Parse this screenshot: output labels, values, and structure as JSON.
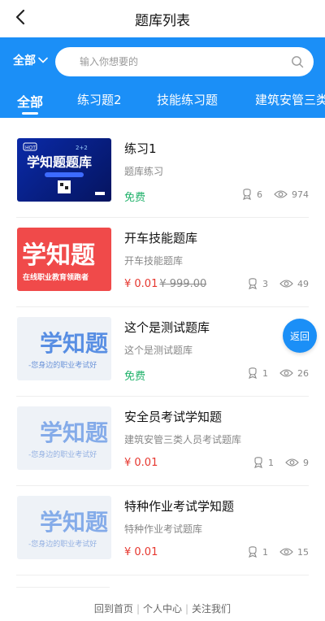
{
  "header": {
    "title": "题库列表"
  },
  "search": {
    "filter_label": "全部",
    "placeholder": "输入你想要的"
  },
  "tabs": [
    {
      "label": "全部"
    },
    {
      "label": "练习题2"
    },
    {
      "label": "技能练习题"
    },
    {
      "label": "建筑安管三类"
    }
  ],
  "items": [
    {
      "name": "练习1",
      "sub": "题库练习",
      "price": "免费",
      "old_price": "",
      "people": "6",
      "views": "974",
      "thumb_text": "学知题题库",
      "thumb_small": "HOT",
      "thumb_extra": "2+2"
    },
    {
      "name": "开车技能题库",
      "sub": "开车技能题库",
      "price": "¥ 0.01",
      "old_price": "¥ 999.00",
      "people": "3",
      "views": "49",
      "thumb_text": "学知题",
      "thumb_small": "在线职业教育领跑者"
    },
    {
      "name": "这个是测试题库",
      "sub": "这个是测试题库",
      "price": "免费",
      "old_price": "",
      "people": "1",
      "views": "26",
      "thumb_text": "学知题",
      "thumb_small": "-您身边的职业考试好"
    },
    {
      "name": "安全员考试学知题",
      "sub": "建筑安管三类人员考试题库",
      "price": "¥ 0.01",
      "old_price": "",
      "people": "1",
      "views": "9",
      "thumb_text": "学知题",
      "thumb_small": "-您身边的职业考试好"
    },
    {
      "name": "特种作业考试学知题",
      "sub": "特种作业考试题库",
      "price": "¥ 0.01",
      "old_price": "",
      "people": "1",
      "views": "15",
      "thumb_text": "学知题",
      "thumb_small": "-您身边的职业考试好"
    }
  ],
  "fab": {
    "label": "返回"
  },
  "footer": {
    "home": "回到首页",
    "center": "个人中心",
    "follow": "关注我们"
  },
  "colors": {
    "brand": "#1b8ff7",
    "free": "#21b26b",
    "price": "#e6362e"
  }
}
